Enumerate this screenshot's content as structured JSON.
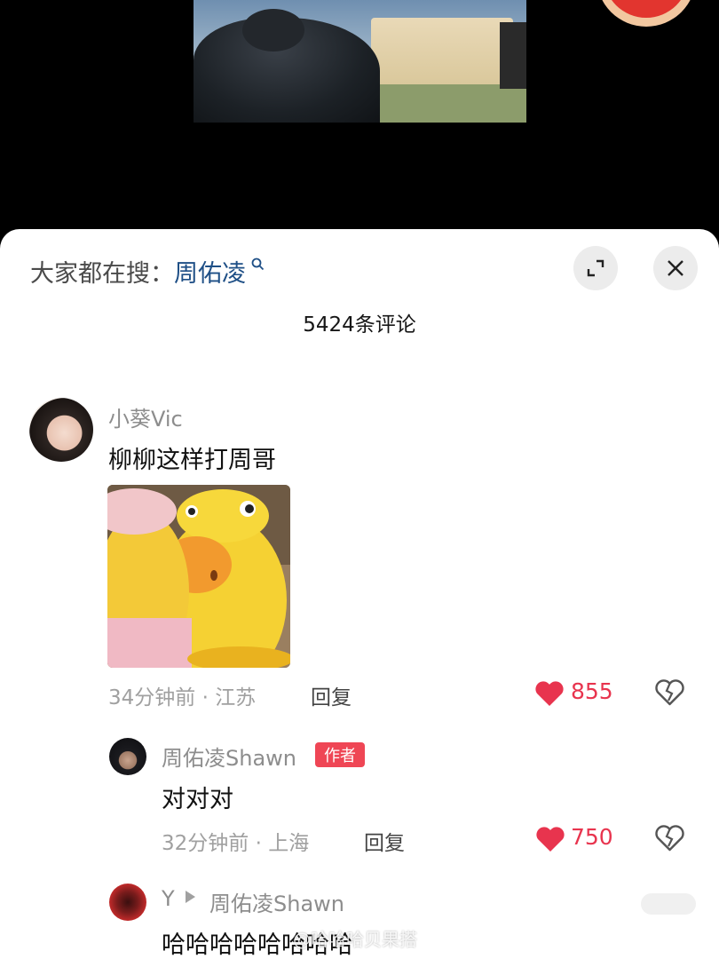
{
  "search": {
    "prefix": "大家都在搜：",
    "keyword": "周佑凌"
  },
  "header": {
    "comment_count": "5424条评论"
  },
  "comments": [
    {
      "user": "小葵Vic",
      "text": "柳柳这样打周哥",
      "time": "34分钟前",
      "location": "江苏",
      "reply_label": "回复",
      "likes": "855"
    },
    {
      "user": "周佑凌Shawn",
      "badge": "作者",
      "text": "对对对",
      "time": "32分钟前",
      "location": "上海",
      "reply_label": "回复",
      "likes": "750"
    },
    {
      "user": "Y",
      "reply_to": "周佑凌Shawn",
      "text": "哈哈哈哈哈哈哈哈"
    }
  ],
  "watermark": "@哈哈哈贝果搭",
  "colors": {
    "accent": "#e8344e",
    "keyword": "#1e4f86",
    "badge": "#ef4655"
  },
  "icons": [
    "search-icon",
    "expand-icon",
    "close-icon",
    "heart-icon",
    "dislike-icon"
  ]
}
